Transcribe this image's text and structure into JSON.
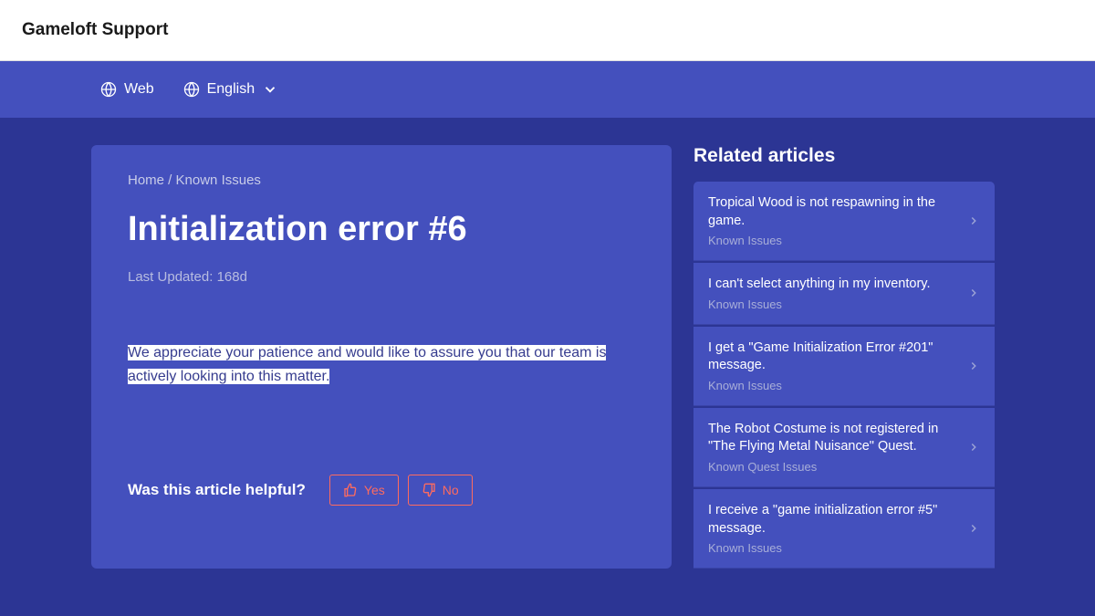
{
  "header": {
    "site_title": "Gameloft Support"
  },
  "nav": {
    "platform_label": "Web",
    "language_label": "English"
  },
  "breadcrumb": {
    "home": "Home",
    "separator": " / ",
    "section": "Known Issues"
  },
  "article": {
    "title": "Initialization error #6",
    "last_updated": "Last Updated: 168d",
    "body": "We appreciate your patience and would like to assure you that our team is actively looking into this matter."
  },
  "feedback": {
    "label": "Was this article helpful?",
    "yes": "Yes",
    "no": "No"
  },
  "sidebar": {
    "title": "Related articles",
    "items": [
      {
        "title": "Tropical Wood is not respawning in the game.",
        "category": "Known Issues"
      },
      {
        "title": "I can't select anything in my inventory.",
        "category": "Known Issues"
      },
      {
        "title": "I get a \"Game Initialization Error #201\" message.",
        "category": "Known Issues"
      },
      {
        "title": "The Robot Costume is not registered in \"The Flying Metal Nuisance\" Quest.",
        "category": "Known Quest Issues"
      },
      {
        "title": "I receive a \"game initialization error #5\" message.",
        "category": "Known Issues"
      }
    ]
  }
}
